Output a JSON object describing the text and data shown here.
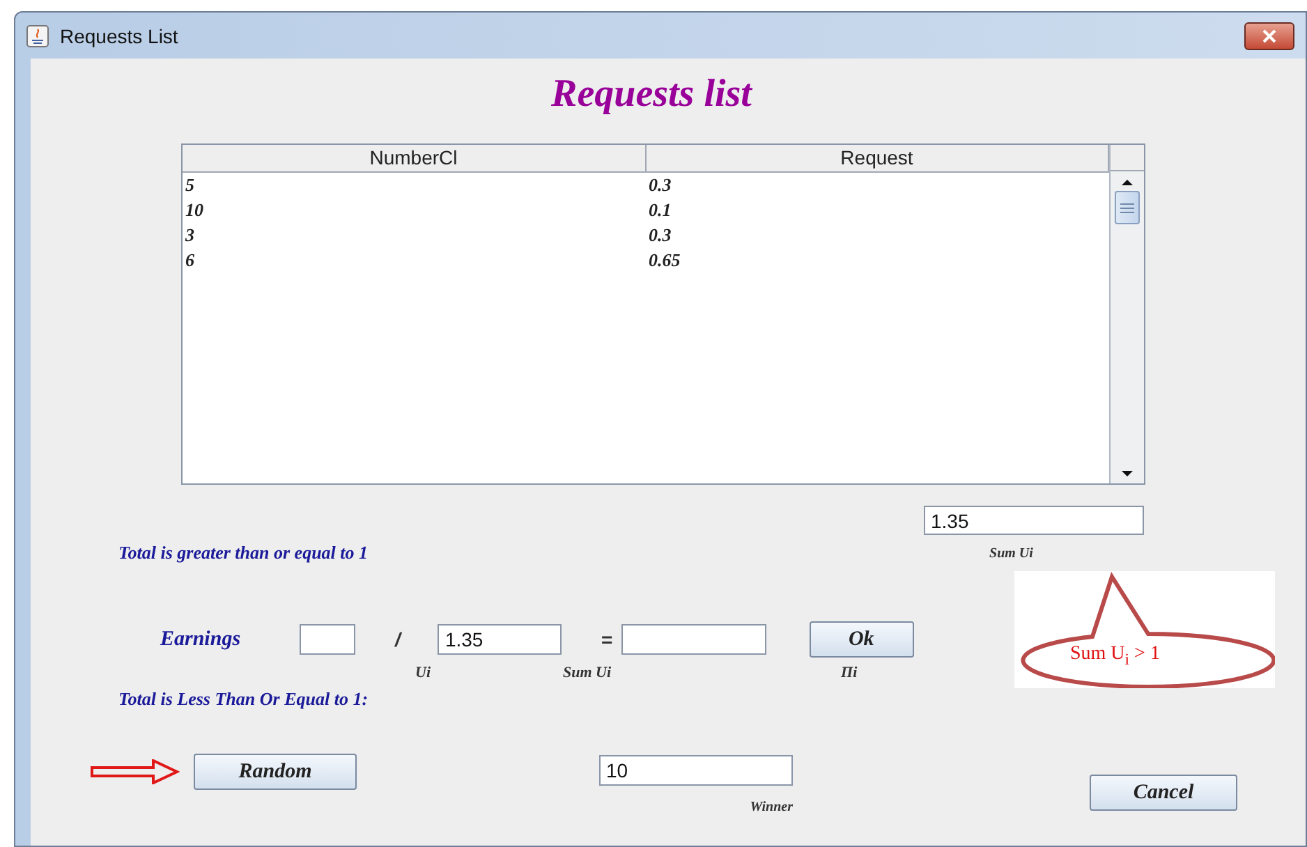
{
  "window": {
    "title": "Requests List"
  },
  "heading": "Requests list",
  "table": {
    "columns": [
      "NumberCl",
      "Request"
    ],
    "rows": [
      [
        "5",
        "0.3"
      ],
      [
        "10",
        "0.1"
      ],
      [
        "3",
        "0.3"
      ],
      [
        "6",
        "0.65"
      ]
    ]
  },
  "sum_field": {
    "value": "1.35"
  },
  "sum_label": "Sum Ui",
  "callout": {
    "text": "Sum U$_{i}$ > 1"
  },
  "greater_section": {
    "title": "Total is greater than or equal to 1",
    "earnings_label": "Earnings",
    "divide_sign": "/",
    "sum_field": {
      "value": "1.35"
    },
    "equals_sign": "=",
    "ok_button": "Ok",
    "labels": [
      "Ui",
      "Sum Ui",
      "Πi"
    ]
  },
  "less_section": {
    "title": "Total is Less Than Or Equal to 1:",
    "random_button": "Random",
    "winner_field": {
      "value": "10"
    },
    "winner_label": "Winner"
  },
  "cancel_button": "Cancel"
}
